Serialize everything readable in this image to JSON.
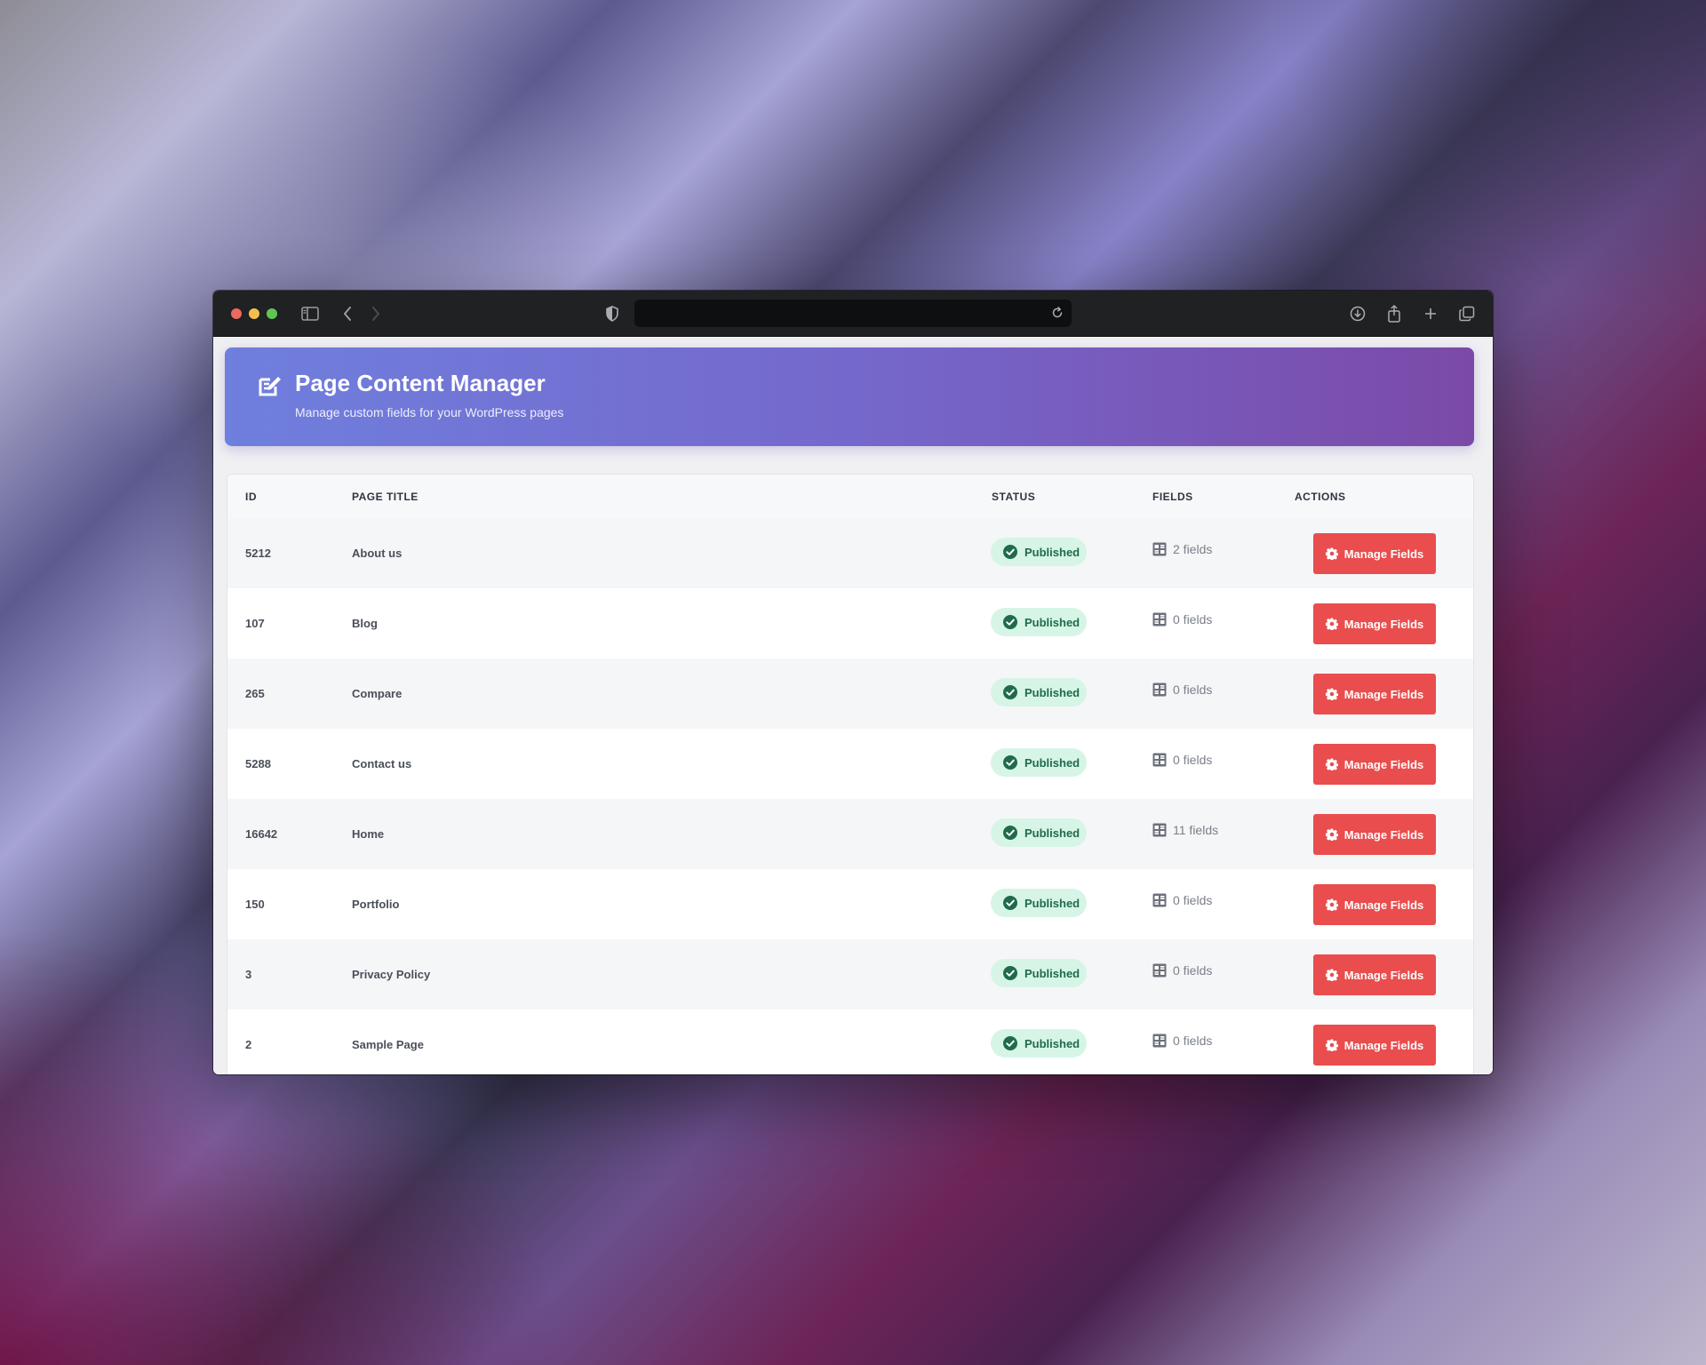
{
  "header": {
    "title": "Page Content Manager",
    "subtitle": "Manage custom fields for your WordPress pages",
    "icon": "edit-note-icon"
  },
  "table": {
    "columns": [
      "ID",
      "PAGE TITLE",
      "STATUS",
      "FIELDS",
      "ACTIONS"
    ],
    "rows": [
      {
        "id": "5212",
        "title": "About us",
        "status": "Published",
        "fields": "2 fields",
        "action": "Manage Fields"
      },
      {
        "id": "107",
        "title": "Blog",
        "status": "Published",
        "fields": "0 fields",
        "action": "Manage Fields"
      },
      {
        "id": "265",
        "title": "Compare",
        "status": "Published",
        "fields": "0 fields",
        "action": "Manage Fields"
      },
      {
        "id": "5288",
        "title": "Contact us",
        "status": "Published",
        "fields": "0 fields",
        "action": "Manage Fields"
      },
      {
        "id": "16642",
        "title": "Home",
        "status": "Published",
        "fields": "11 fields",
        "action": "Manage Fields"
      },
      {
        "id": "150",
        "title": "Portfolio",
        "status": "Published",
        "fields": "0 fields",
        "action": "Manage Fields"
      },
      {
        "id": "3",
        "title": "Privacy Policy",
        "status": "Published",
        "fields": "0 fields",
        "action": "Manage Fields"
      },
      {
        "id": "2",
        "title": "Sample Page",
        "status": "Published",
        "fields": "0 fields",
        "action": "Manage Fields"
      }
    ]
  },
  "colors": {
    "accent_gradient_start": "#6f7fdd",
    "accent_gradient_end": "#7b4aa8",
    "status_published_bg": "#d6f5e6",
    "status_published_text": "#1f6b4a",
    "action_button": "#e94d4d"
  }
}
